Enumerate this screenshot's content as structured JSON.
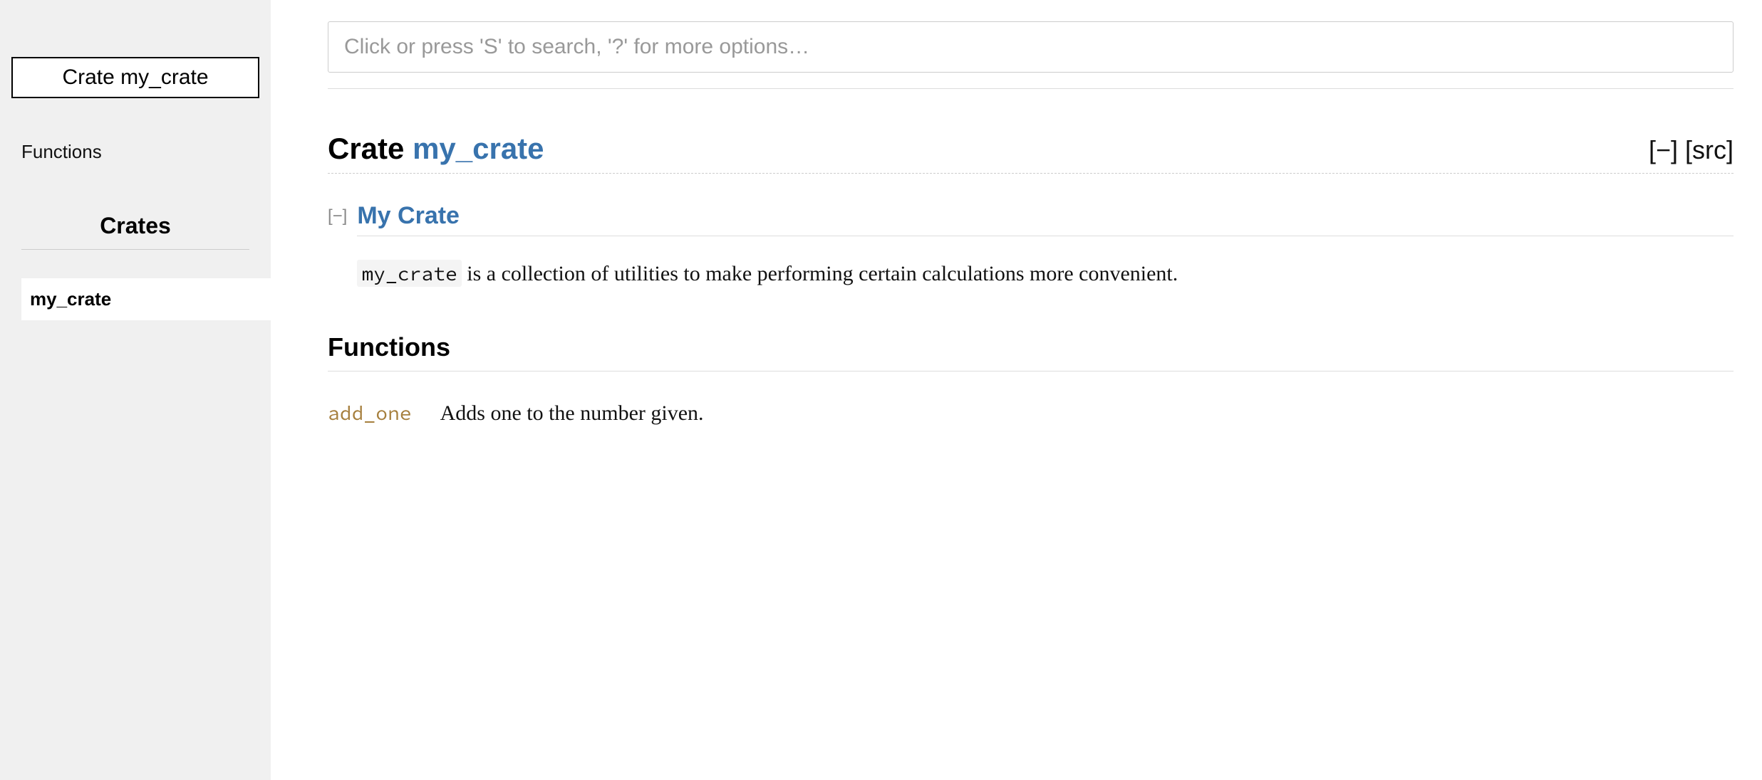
{
  "sidebar": {
    "crate_title_prefix": "Crate ",
    "crate_title_name": "my_crate",
    "section_functions": "Functions",
    "crates_heading": "Crates",
    "crate_items": [
      "my_crate"
    ]
  },
  "search": {
    "placeholder": "Click or press 'S' to search, '?' for more options…"
  },
  "heading": {
    "kind": "Crate ",
    "name": "my_crate",
    "collapse": "[−]",
    "src": "[src]"
  },
  "doc": {
    "toggle": "[−]",
    "title": "My Crate",
    "code": "my_crate",
    "desc_after_code": " is a collection of utilities to make performing certain calculations more convenient."
  },
  "functions_section": "Functions",
  "functions": [
    {
      "name": "add_one",
      "desc": "Adds one to the number given."
    }
  ]
}
